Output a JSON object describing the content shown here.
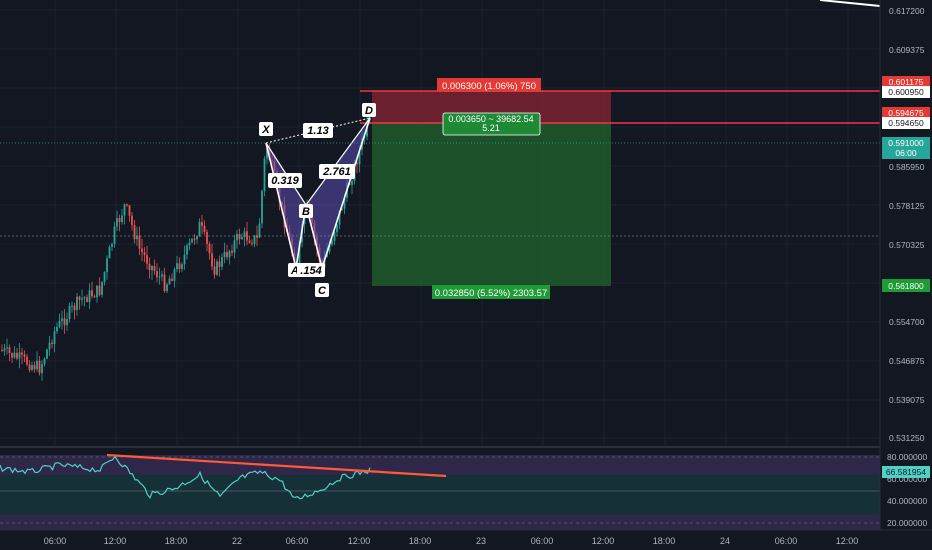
{
  "price_axis": {
    "ticks": [
      "0.617200",
      "0.609375",
      "0.585950",
      "0.578125",
      "0.570325",
      "0.554700",
      "0.546875",
      "0.539075",
      "0.531250"
    ]
  },
  "price_badges": {
    "stop_top": "0.601175",
    "stop_bottom": "0.600950",
    "entry_top": "0.594675",
    "entry_bottom": "0.594650",
    "current_price": "0.591000",
    "countdown": "06:00",
    "target": "0.561800"
  },
  "position_tool": {
    "stop_label": "0.006300 (1.06%) 750",
    "entry_label_line1": "0.003650 ~ 39682.54",
    "entry_label_line2": "5.21",
    "target_label": "0.032850 (5.52%) 2303.57"
  },
  "pattern": {
    "points": [
      "X",
      "A",
      "B",
      "C",
      "D"
    ],
    "ratios": {
      "xb": "0.319",
      "ac": ".154",
      "bd": "2.761",
      "xd": "1.13"
    }
  },
  "rsi": {
    "ticks": [
      "80.000000",
      "60.000000",
      "40.000000",
      "20.000000"
    ],
    "current_value": "66.581954"
  },
  "time_axis": {
    "labels": [
      "06:00",
      "12:00",
      "18:00",
      "22",
      "06:00",
      "12:00",
      "18:00",
      "23",
      "06:00",
      "12:00",
      "18:00",
      "24",
      "06:00",
      "12:00"
    ]
  },
  "colors": {
    "background": "#131722",
    "bull": "#26a69a",
    "bear": "#ef5350",
    "stop_zone": "#7a2230",
    "target_zone": "#1e5b2a",
    "pattern_fill": "#5b4fb0",
    "rsi_line": "#4fd1c5",
    "trendline": "#ff5a36"
  }
}
